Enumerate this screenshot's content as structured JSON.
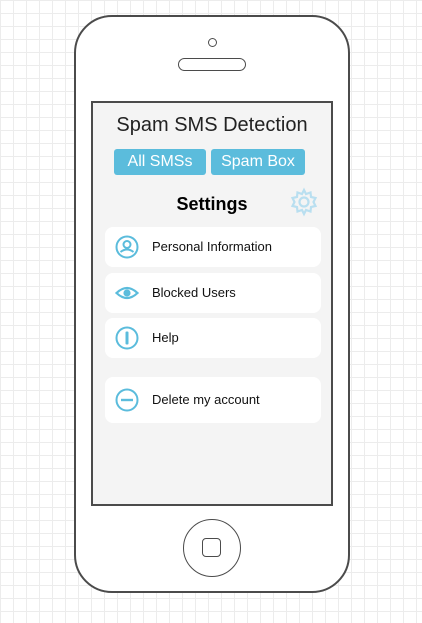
{
  "app": {
    "title": "Spam SMS Detection"
  },
  "tabs": [
    {
      "label": "All SMSs"
    },
    {
      "label": "Spam Box"
    }
  ],
  "settings": {
    "title": "Settings",
    "items": [
      {
        "label": "Personal Information",
        "icon": "user-icon"
      },
      {
        "label": "Blocked Users",
        "icon": "eye-icon"
      },
      {
        "label": "Help",
        "icon": "info-icon"
      },
      {
        "label": "Delete my account",
        "icon": "minus-circle-icon"
      }
    ]
  },
  "colors": {
    "accent": "#5bbcdc",
    "frame": "#4b4b4b",
    "screen_bg": "#f4f4f4"
  }
}
